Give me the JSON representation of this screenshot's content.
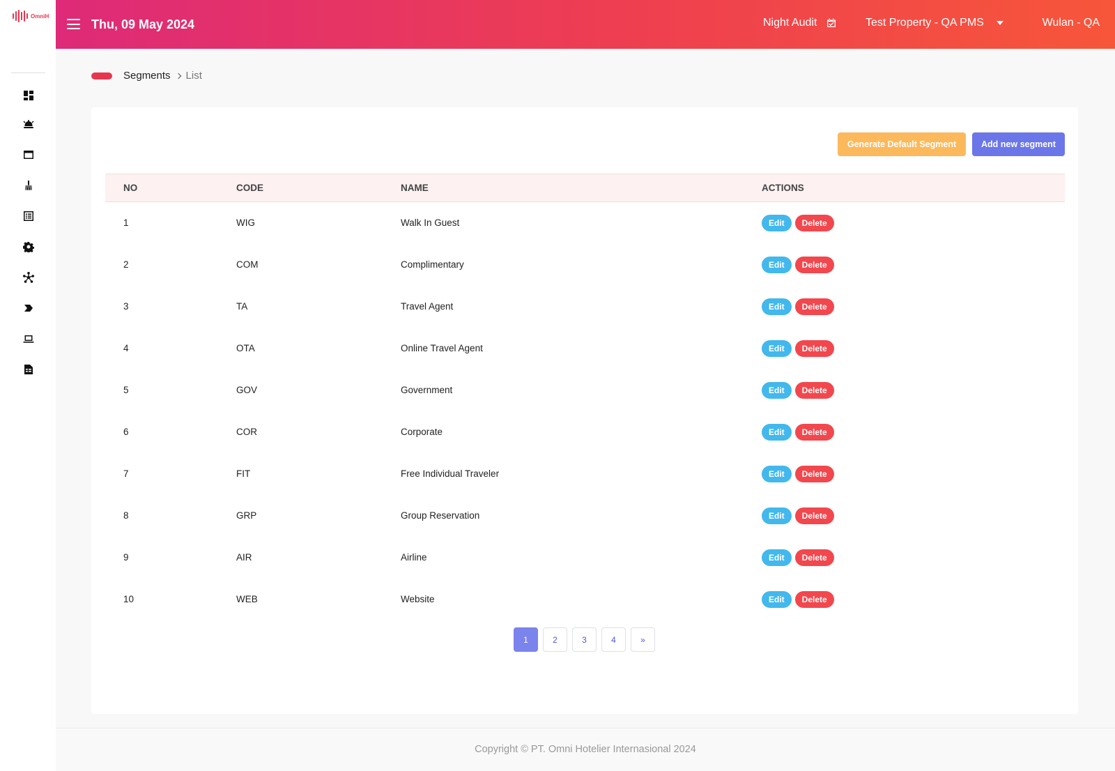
{
  "brand": {
    "logo_text": "OmniH",
    "accent_color": "#e8354f"
  },
  "sidebar": {
    "items": [
      {
        "icon": "dashboard-icon"
      },
      {
        "icon": "bell-concierge-icon"
      },
      {
        "icon": "window-icon"
      },
      {
        "icon": "broom-icon"
      },
      {
        "icon": "list-icon"
      },
      {
        "icon": "gear-icon"
      },
      {
        "icon": "network-icon"
      },
      {
        "icon": "chevron-tag-icon"
      },
      {
        "icon": "laptop-icon"
      },
      {
        "icon": "report-icon"
      }
    ]
  },
  "header": {
    "date": "Thu, 09 May 2024",
    "night_audit_label": "Night Audit",
    "property": "Test Property - QA PMS",
    "user": "Wulan - QA"
  },
  "breadcrumb": {
    "section": "Segments",
    "current": "List"
  },
  "actions": {
    "generate_label": "Generate Default Segment",
    "add_label": "Add new segment"
  },
  "table": {
    "headers": {
      "no": "NO",
      "code": "CODE",
      "name": "NAME",
      "actions": "ACTIONS"
    },
    "edit_label": "Edit",
    "delete_label": "Delete",
    "rows": [
      {
        "no": "1",
        "code": "WIG",
        "name": "Walk In Guest"
      },
      {
        "no": "2",
        "code": "COM",
        "name": "Complimentary"
      },
      {
        "no": "3",
        "code": "TA",
        "name": "Travel Agent"
      },
      {
        "no": "4",
        "code": "OTA",
        "name": "Online Travel Agent"
      },
      {
        "no": "5",
        "code": "GOV",
        "name": "Government"
      },
      {
        "no": "6",
        "code": "COR",
        "name": "Corporate"
      },
      {
        "no": "7",
        "code": "FIT",
        "name": "Free Individual Traveler"
      },
      {
        "no": "8",
        "code": "GRP",
        "name": "Group Reservation"
      },
      {
        "no": "9",
        "code": "AIR",
        "name": "Airline"
      },
      {
        "no": "10",
        "code": "WEB",
        "name": "Website"
      }
    ]
  },
  "pagination": {
    "pages": [
      "1",
      "2",
      "3",
      "4"
    ],
    "current": "1",
    "next_label": "»"
  },
  "footer": {
    "copyright": "Copyright © PT. Omni Hotelier Internasional 2024"
  }
}
